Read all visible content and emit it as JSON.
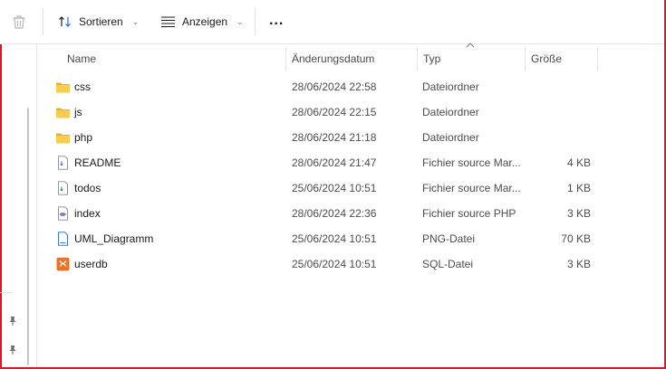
{
  "toolbar": {
    "delete_icon": "trash-icon",
    "sort_label": "Sortieren",
    "view_label": "Anzeigen",
    "more_label": "..."
  },
  "columns": {
    "name": "Name",
    "modified": "Änderungsdatum",
    "type": "Typ",
    "size": "Größe"
  },
  "files": [
    {
      "name": "css",
      "modified": "28/06/2024 22:58",
      "type": "Dateiordner",
      "size": "",
      "icon": "folder-icon"
    },
    {
      "name": "js",
      "modified": "28/06/2024 22:15",
      "type": "Dateiordner",
      "size": "",
      "icon": "folder-icon"
    },
    {
      "name": "php",
      "modified": "28/06/2024 21:18",
      "type": "Dateiordner",
      "size": "",
      "icon": "folder-icon"
    },
    {
      "name": "README",
      "modified": "28/06/2024 21:47",
      "type": "Fichier source Mar...",
      "size": "4 KB",
      "icon": "markdown-file-icon"
    },
    {
      "name": "todos",
      "modified": "25/06/2024 10:51",
      "type": "Fichier source Mar...",
      "size": "1 KB",
      "icon": "markdown-file-icon"
    },
    {
      "name": "index",
      "modified": "28/06/2024 22:36",
      "type": "Fichier source PHP",
      "size": "3 KB",
      "icon": "php-file-icon"
    },
    {
      "name": "UML_Diagramm",
      "modified": "25/06/2024 10:51",
      "type": "PNG-Datei",
      "size": "70 KB",
      "icon": "image-file-icon"
    },
    {
      "name": "userdb",
      "modified": "25/06/2024 10:51",
      "type": "SQL-Datei",
      "size": "3 KB",
      "icon": "sql-file-icon"
    }
  ],
  "colors": {
    "accent_border": "#e81123",
    "folder": "#f3c13a",
    "sql_icon": "#f37021"
  }
}
